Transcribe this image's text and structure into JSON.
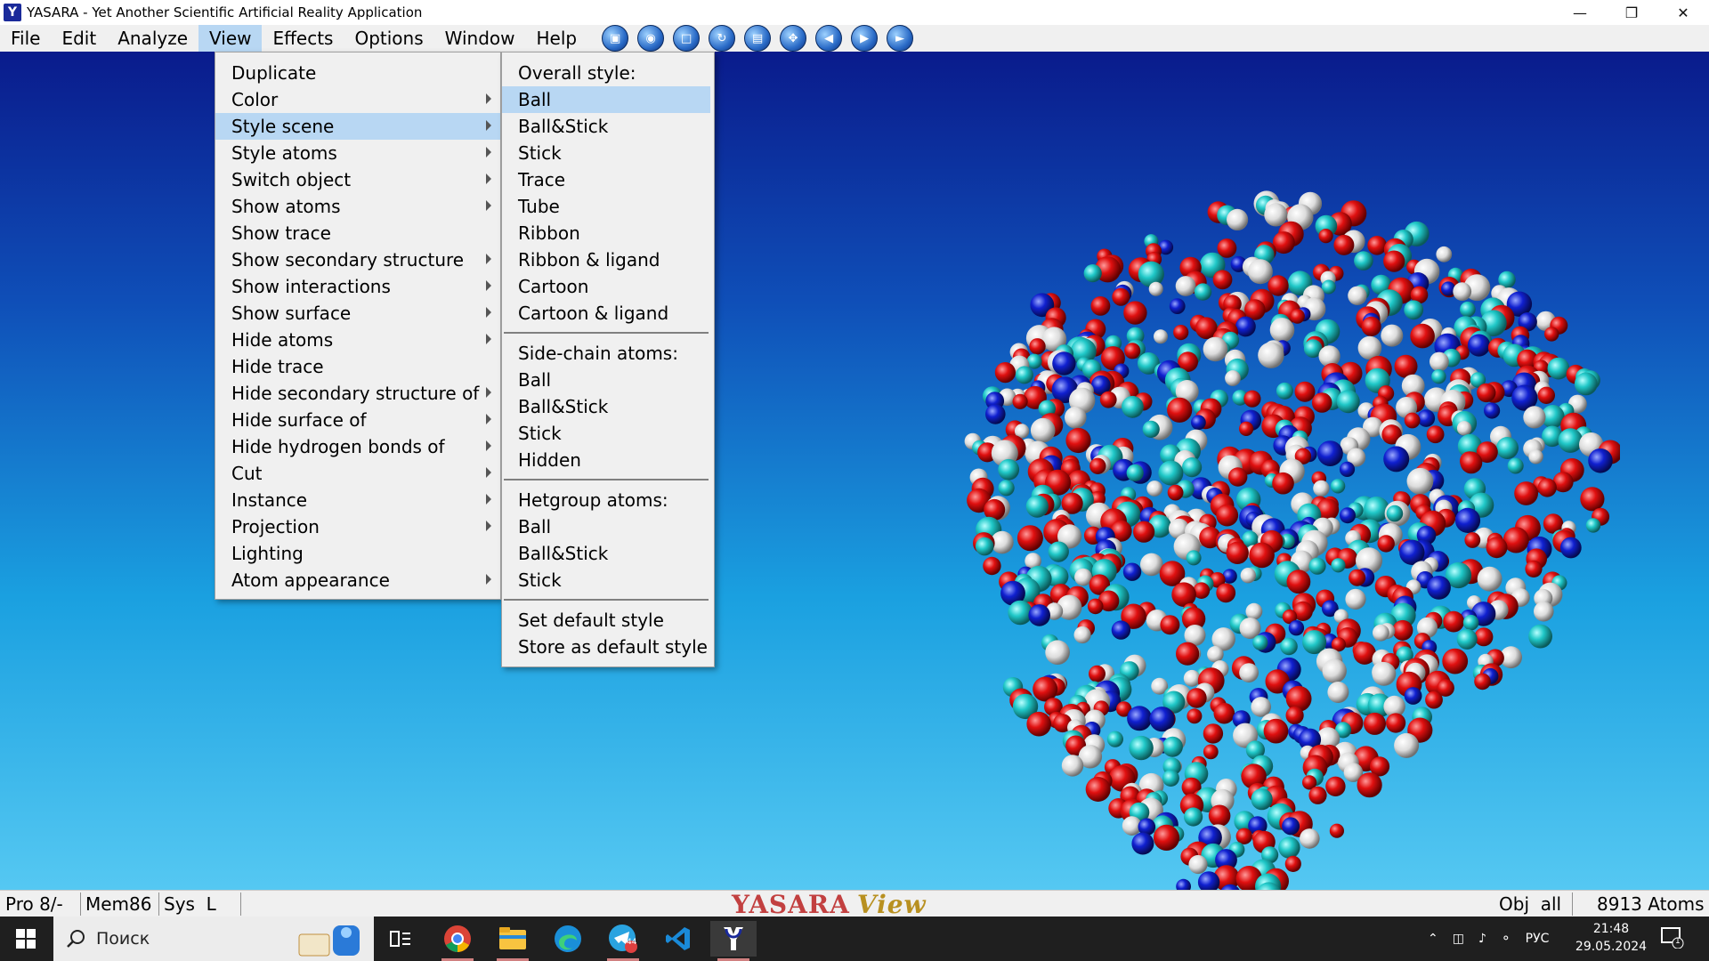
{
  "window": {
    "title": "YASARA - Yet Another Scientific Artificial Reality Application",
    "app_icon_glyph": "Y",
    "controls": [
      "minimize-icon",
      "restore-icon",
      "close-icon"
    ]
  },
  "menubar": {
    "items": [
      {
        "label": "File"
      },
      {
        "label": "Edit"
      },
      {
        "label": "Analyze"
      },
      {
        "label": "View",
        "active": true
      },
      {
        "label": "Effects"
      },
      {
        "label": "Options"
      },
      {
        "label": "Window"
      },
      {
        "label": "Help"
      }
    ],
    "toolbar_icons": [
      "select-box-icon",
      "globe-icon",
      "page-icon",
      "rotate-icon",
      "save-icon",
      "center-icon",
      "back-icon",
      "forward-icon",
      "play-icon"
    ]
  },
  "view_menu": {
    "items": [
      {
        "label": "Duplicate",
        "submenu": false
      },
      {
        "label": "Color",
        "submenu": true
      },
      {
        "label": "Style scene",
        "submenu": true,
        "highlight": true
      },
      {
        "label": "Style atoms",
        "submenu": true
      },
      {
        "label": "Switch object",
        "submenu": true
      },
      {
        "label": "Show atoms",
        "submenu": true
      },
      {
        "label": "Show trace",
        "submenu": false
      },
      {
        "label": "Show secondary structure",
        "submenu": true
      },
      {
        "label": "Show interactions",
        "submenu": true
      },
      {
        "label": "Show surface",
        "submenu": true
      },
      {
        "label": "Hide atoms",
        "submenu": true
      },
      {
        "label": "Hide trace",
        "submenu": false
      },
      {
        "label": "Hide secondary structure of",
        "submenu": true
      },
      {
        "label": "Hide surface of",
        "submenu": true
      },
      {
        "label": "Hide hydrogen bonds of",
        "submenu": true
      },
      {
        "label": "Cut",
        "submenu": true
      },
      {
        "label": "Instance",
        "submenu": true
      },
      {
        "label": "Projection",
        "submenu": true
      },
      {
        "label": "Lighting",
        "submenu": false
      },
      {
        "label": "Atom appearance",
        "submenu": true
      }
    ]
  },
  "style_submenu": {
    "groups": [
      {
        "header": "Overall style:",
        "items": [
          "Ball",
          "Ball&Stick",
          "Stick",
          "Trace",
          "Tube",
          "Ribbon",
          "Ribbon & ligand",
          "Cartoon",
          "Cartoon & ligand"
        ]
      },
      {
        "header": "Side-chain atoms:",
        "items": [
          "Ball",
          "Ball&Stick",
          "Stick",
          "Hidden"
        ]
      },
      {
        "header": "Hetgroup atoms:",
        "items": [
          "Ball",
          "Ball&Stick",
          "Stick"
        ]
      },
      {
        "header": "",
        "items": [
          "Set default style",
          "Store as default style"
        ]
      }
    ],
    "highlighted_item": "Ball"
  },
  "statusbar": {
    "pro": "Pro 8/-",
    "mem": "Mem86",
    "sys": "Sys  L",
    "logo_text": "YASARA",
    "logo_edition": "View",
    "obj": "Obj  all",
    "atoms": "8913 Atoms"
  },
  "taskbar": {
    "search_placeholder": "Поиск",
    "apps": [
      "notes-app-icon",
      "task-view-icon",
      "chrome-icon",
      "file-explorer-icon",
      "edge-icon",
      "telegram-icon",
      "vscode-icon",
      "yasara-icon"
    ],
    "telegram_badge": "44",
    "language": "РУС",
    "time": "21:48",
    "date": "29.05.2024",
    "notification_count": "1"
  },
  "colors": {
    "menu_highlight": "#b8d7f3",
    "atom_oxygen": "#e01010",
    "atom_carbon": "#20c8c8",
    "atom_nitrogen": "#1020d0",
    "atom_hydrogen": "#f0f0f0"
  }
}
